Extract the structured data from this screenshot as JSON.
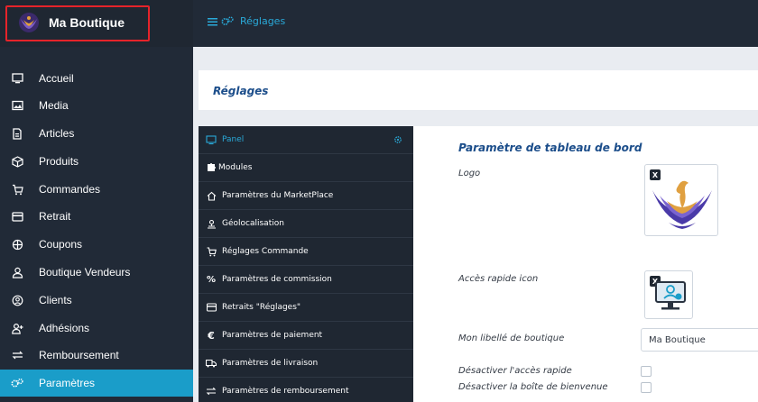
{
  "brand": {
    "name": "Ma Boutique",
    "logo_icon": "phoenix-logo-icon"
  },
  "topbar": {
    "menu_icon": "hamburger-icon",
    "settings_icon": "gears-icon",
    "title": "Réglages"
  },
  "sidebar": {
    "items": [
      {
        "label": "Accueil",
        "icon": "monitor-icon"
      },
      {
        "label": "Media",
        "icon": "image-icon"
      },
      {
        "label": "Articles",
        "icon": "document-icon"
      },
      {
        "label": "Produits",
        "icon": "box-icon"
      },
      {
        "label": "Commandes",
        "icon": "cart-icon"
      },
      {
        "label": "Retrait",
        "icon": "card-icon"
      },
      {
        "label": "Coupons",
        "icon": "coupon-icon"
      },
      {
        "label": "Boutique Vendeurs",
        "icon": "person-icon"
      },
      {
        "label": "Clients",
        "icon": "user-circle-icon"
      },
      {
        "label": "Adhésions",
        "icon": "user-plus-icon"
      },
      {
        "label": "Remboursement",
        "icon": "refund-icon"
      },
      {
        "label": "Paramètres",
        "icon": "gears-icon",
        "active": true
      }
    ]
  },
  "page": {
    "title": "Réglages"
  },
  "settings_menu": {
    "items": [
      {
        "label": "Panel",
        "icon": "monitor-icon",
        "active": true
      },
      {
        "label": "Modules",
        "icon": "puzzle-icon"
      },
      {
        "label": "Paramètres du MarketPlace",
        "icon": "home-icon"
      },
      {
        "label": "Géolocalisation",
        "icon": "location-icon"
      },
      {
        "label": "Réglages Commande",
        "icon": "cart-icon"
      },
      {
        "label": "Paramètres de commission",
        "icon": "percent-icon"
      },
      {
        "label": "Retraits \"Réglages\"",
        "icon": "card-icon"
      },
      {
        "label": "Paramètres de paiement",
        "icon": "euro-icon"
      },
      {
        "label": "Paramètres de livraison",
        "icon": "truck-icon"
      },
      {
        "label": "Paramètres de remboursement",
        "icon": "refund-icon"
      }
    ]
  },
  "content": {
    "section_title": "Paramètre de tableau de bord",
    "logo_label": "Logo",
    "quick_icon_label": "Accès rapide icon",
    "shop_label_label": "Mon libellé de boutique",
    "shop_label_value": "Ma Boutique",
    "disable_quick_access_label": "Désactiver l'accès rapide",
    "disable_welcome_box_label": "Désactiver la boîte de bienvenue",
    "remove_badge": "X"
  },
  "colors": {
    "sidebar_bg": "#212a37",
    "accent": "#1a9dc9",
    "title_blue": "#1b4d8a",
    "highlight": "#e6232a"
  }
}
